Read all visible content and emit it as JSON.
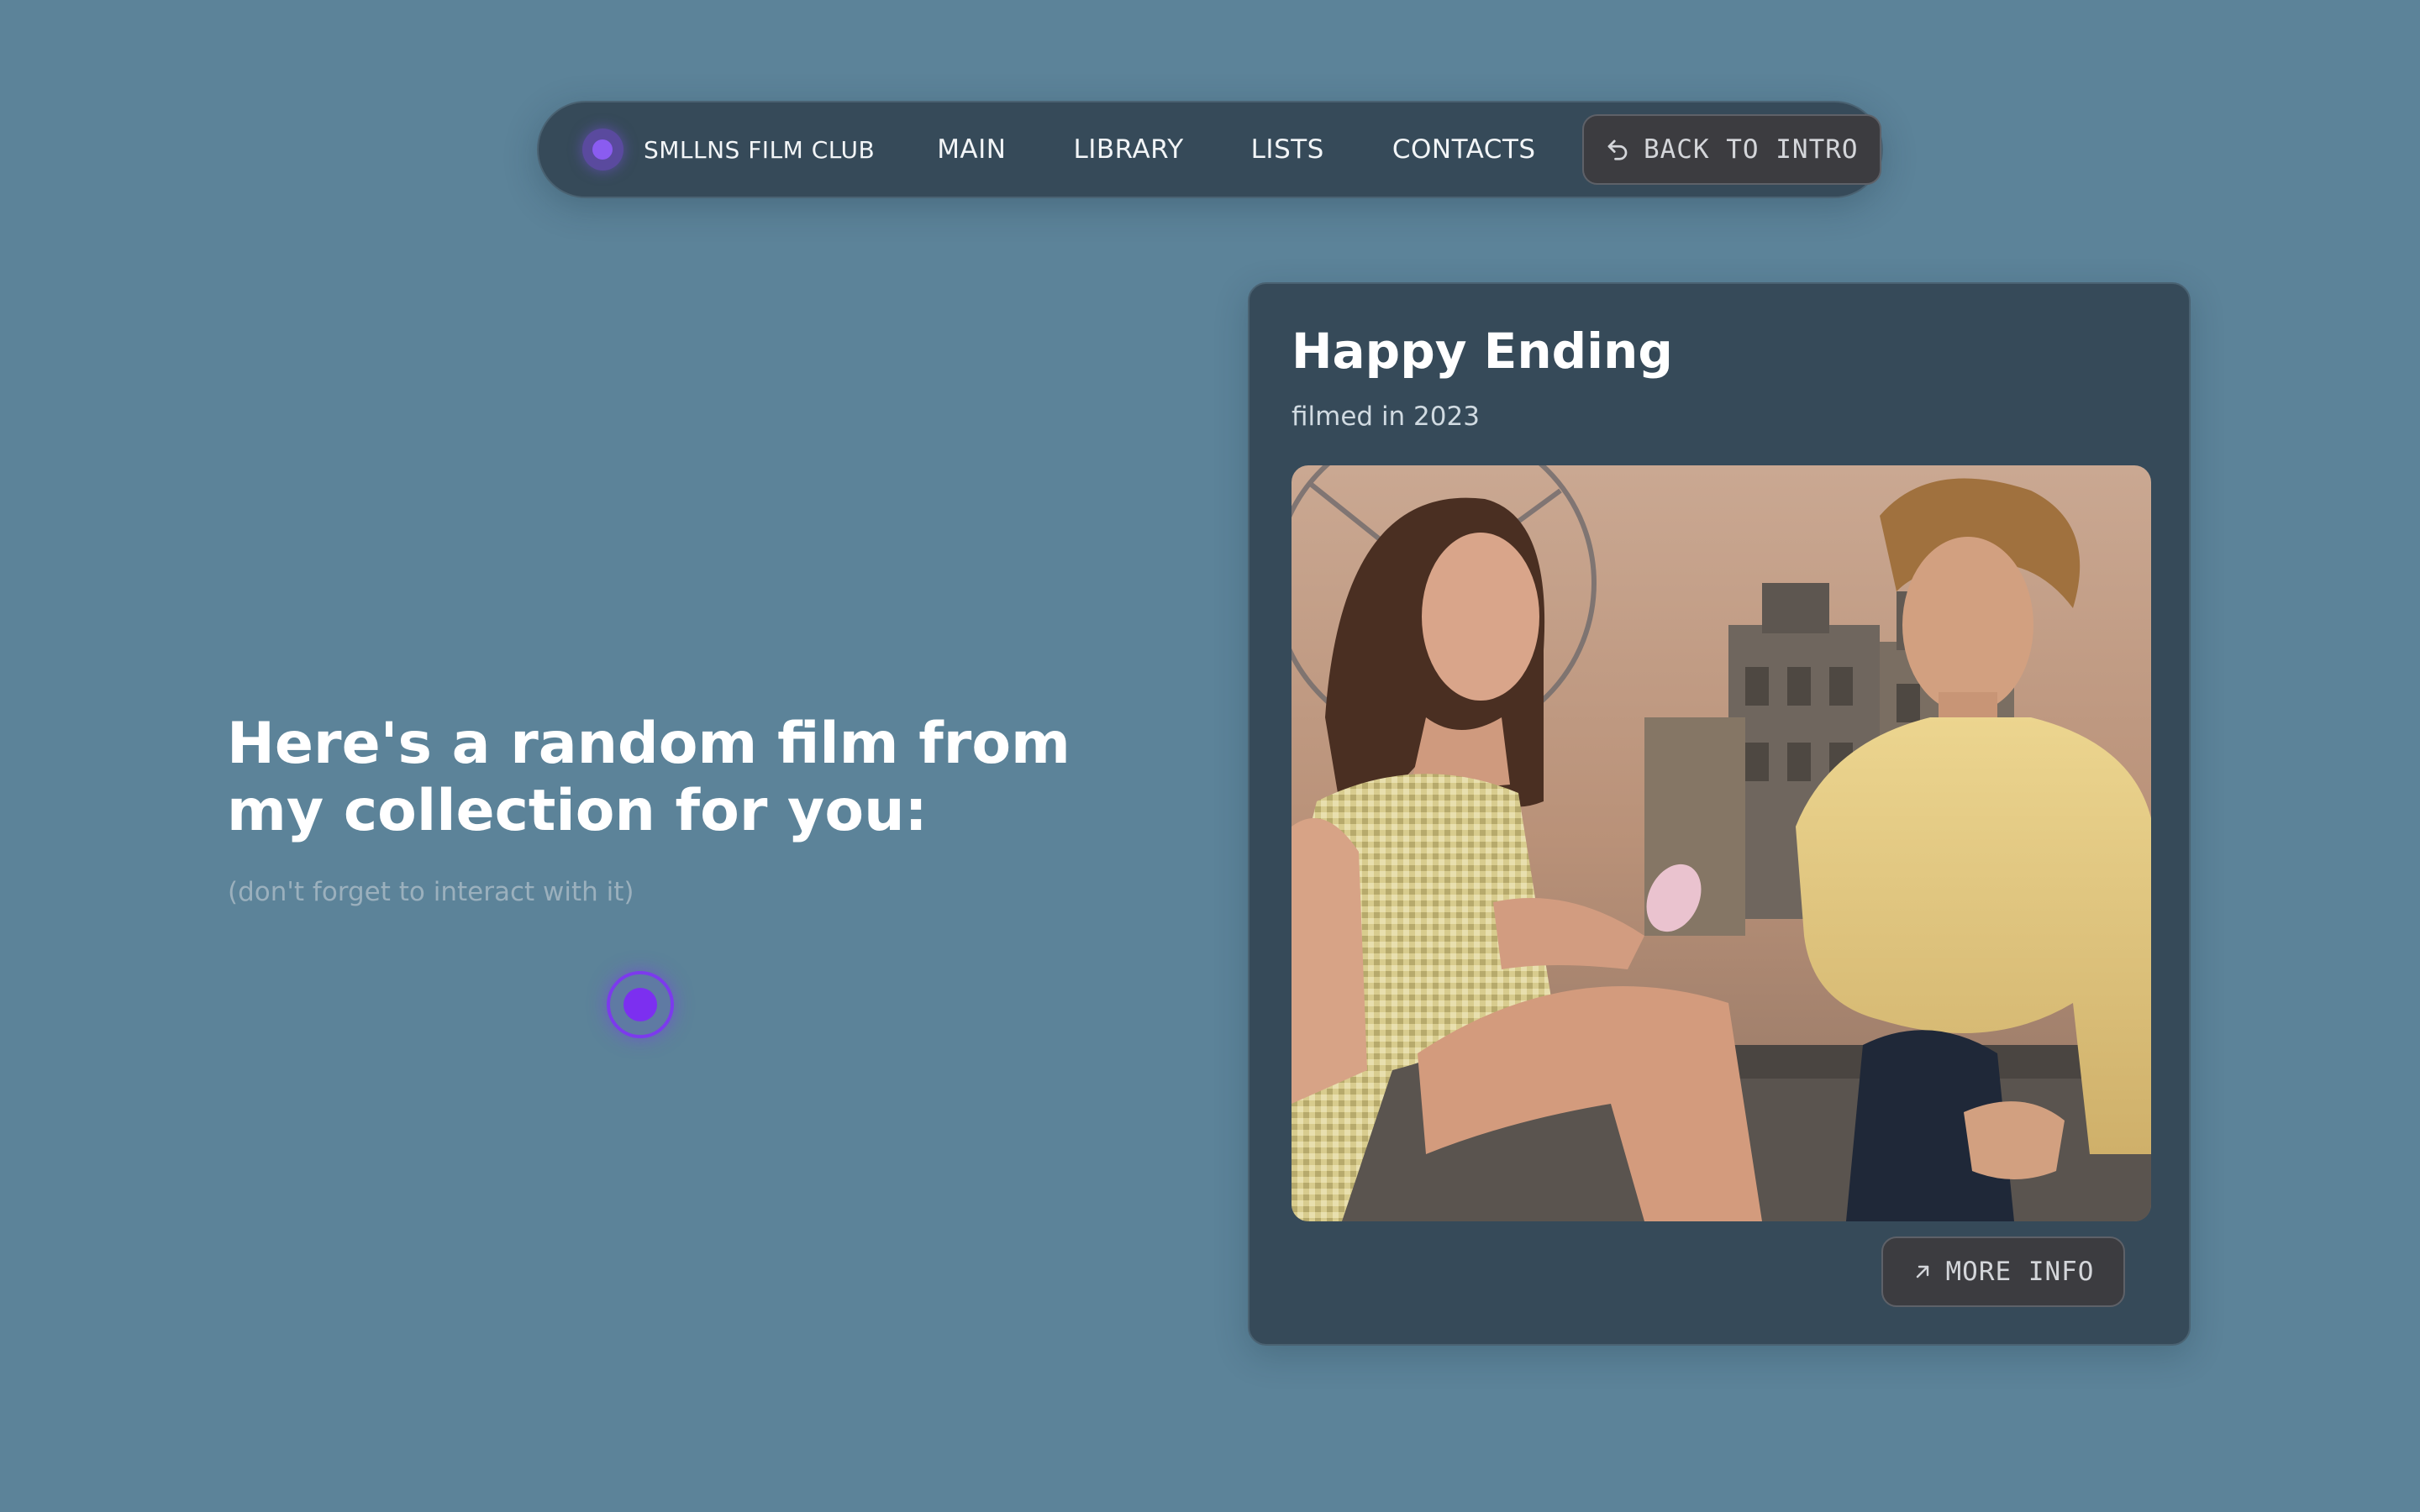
{
  "nav": {
    "brand": "SMLLNS FILM CLUB",
    "links": [
      "MAIN",
      "LIBRARY",
      "LISTS",
      "CONTACTS"
    ],
    "back_button": {
      "label": "BACK TO INTRO",
      "icon": "undo-arrow-icon"
    }
  },
  "hero": {
    "title": "Here's a random film from my collection for you:",
    "subtitle": "(don't forget to interact with it)"
  },
  "film": {
    "title": "Happy Ending",
    "year_text": "filmed in 2023",
    "more_button": {
      "label": "MORE INFO",
      "icon": "arrow-up-right-icon"
    }
  },
  "colors": {
    "background": "#5c8399",
    "panel": "#364a59",
    "accent": "#7c3aed",
    "button": "#3c3c40"
  }
}
